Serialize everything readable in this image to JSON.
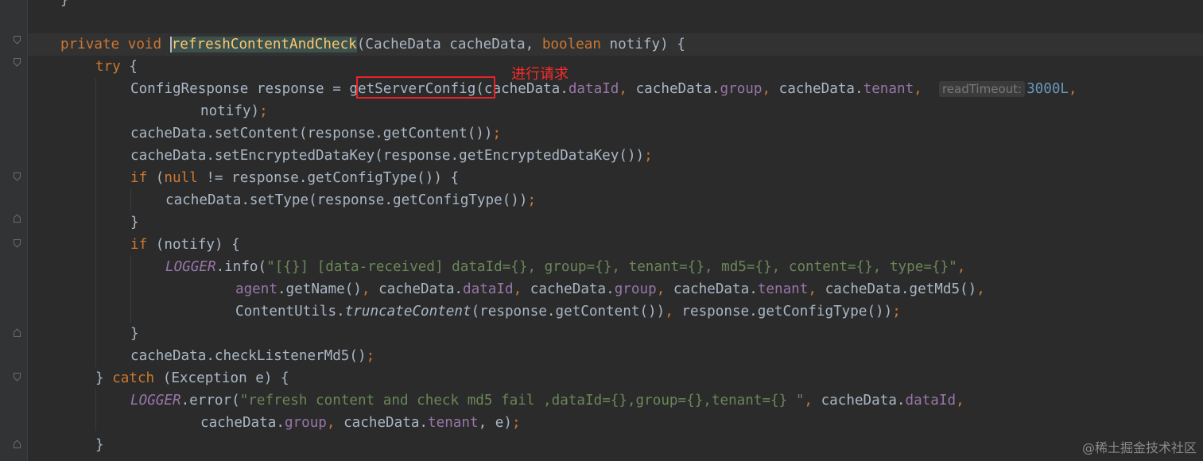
{
  "code": {
    "top_brace": "}",
    "kw_private": "private",
    "kw_void": "void",
    "method_name": "refreshContentAndCheck",
    "sig_params": "(CacheData cacheData, ",
    "kw_boolean": "boolean",
    "sig_tail": " notify) {",
    "kw_try": "try",
    "try_open": " {",
    "resp_decl": "ConfigResponse response = ",
    "call_get_server_config": "getServerConfig",
    "arg1_pre": "(cacheData.",
    "f_dataId": "dataId",
    "comma": ", ",
    "cacheData_dot": "cacheData.",
    "f_group": "group",
    "f_tenant": "tenant",
    "hint_read_timeout": "readTimeout:",
    "num_3000L": "3000L",
    "trailing_comma": ",",
    "notify_arg": "notify)",
    "semi": ";",
    "set_content": "cacheData.setContent(response.getContent())",
    "set_enc_key": "cacheData.setEncryptedDataKey(response.getEncryptedDataKey())",
    "kw_if": "if",
    "if_null_pre": " (",
    "kw_null": "null",
    "if_null_post": " != response.getConfigType()) {",
    "set_type": "cacheData.setType(response.getConfigType())",
    "close_brace": "}",
    "if_notify": " (notify) {",
    "logger": "LOGGER",
    "info_call": ".info(",
    "info_str": "\"[{}] [data-received] dataId={}, group={}, tenant={}, md5={}, content={}, type={}\"",
    "agent": "agent",
    "get_name": ".getName()",
    "get_md5": "cacheData.getMd5()",
    "content_utils": "ContentUtils.",
    "truncate_content": "truncateContent",
    "truncate_args": "(response.getContent())",
    "get_config_type_end": "response.getConfigType())",
    "check_md5": "cacheData.checkListenerMd5()",
    "catch_close": "} ",
    "kw_catch": "catch",
    "catch_tail": " (Exception e) {",
    "error_call": ".error(",
    "error_str": "\"refresh content and check md5 fail ,dataId={},group={},tenant={} \"",
    "err_tail": ", e)"
  },
  "annotation_label": "进行请求",
  "watermark": "@稀土掘金技术社区",
  "colors": {
    "background": "#2b2b2b",
    "keyword": "#cc7832",
    "method": "#ffc66d",
    "field": "#9876aa",
    "string": "#6a8759",
    "number": "#6897bb",
    "annotation_red": "#e8232b"
  }
}
